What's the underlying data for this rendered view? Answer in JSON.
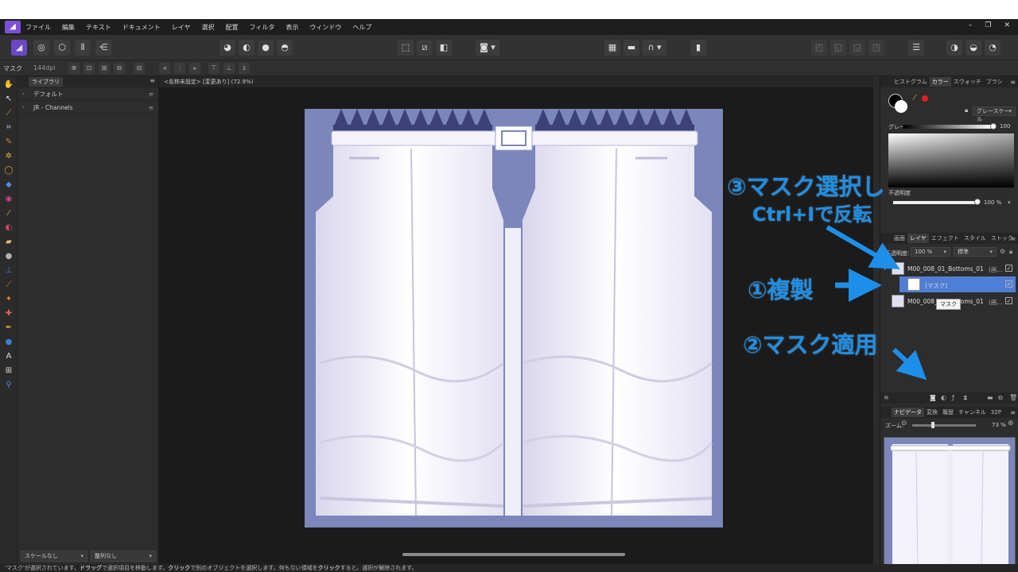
{
  "menu": [
    "ファイル",
    "編集",
    "テキスト",
    "ドキュメント",
    "レイヤ",
    "選択",
    "配置",
    "フィルタ",
    "表示",
    "ウィンドウ",
    "ヘルプ"
  ],
  "context": {
    "mode": "マスク",
    "dpi": "144dpi"
  },
  "library": {
    "tab": "ライブラリ",
    "items": [
      "デフォルト",
      "JR - Channels"
    ],
    "scale_select": "スケールなし",
    "align_select": "整列なし",
    "search_placeholder": "検索"
  },
  "document": {
    "title": "<名称未設定> [変更あり] (72.9%)"
  },
  "color_panel": {
    "tabs": [
      "ヒストグラム",
      "カラー",
      "スウォッチ",
      "ブラシ"
    ],
    "active_tab": "カラー",
    "model": "グレースケール",
    "gray_label": "グレー",
    "gray_value": "100",
    "opacity_label": "不透明度",
    "opacity_value": "100 %"
  },
  "layers_panel": {
    "tabs": [
      "画面",
      "レイヤ",
      "エフェクト",
      "スタイル",
      "ストック"
    ],
    "active_tab": "レイヤ",
    "opacity_label": "不透明度:",
    "opacity_value": "100 %",
    "blend_mode": "標準",
    "layers": [
      {
        "name": "M00_008_01_Bottoms_01",
        "suffix": "(画...",
        "level": 0,
        "selected": false
      },
      {
        "name": "(マスク)",
        "level": 1,
        "selected": true
      },
      {
        "name": "M00_008_01_Bottoms_01",
        "suffix": "(画...",
        "level": 0,
        "selected": false
      }
    ],
    "tooltip": "マスク"
  },
  "navigator_panel": {
    "tabs": [
      "ナビゲータ",
      "変換",
      "履歴",
      "チャンネル",
      "32P"
    ],
    "active_tab": "ナビゲータ",
    "zoom_label": "ズーム:",
    "zoom_value": "73 %"
  },
  "status": {
    "prefix": "'マスク'が選択されています。",
    "drag": "ドラッグ",
    "mid1": "で選択項目を移動します。",
    "click": "クリック",
    "mid2": "で別のオブジェクトを選択します。何もない領域を",
    "click2": "クリック",
    "suffix": "すると、選択が解除されます。"
  },
  "annotations": {
    "step3_line1": "③マスク選択し",
    "step3_line2": "Ctrl+Iで反転",
    "step1": "①複製",
    "step2": "②マスク適用"
  },
  "colors": {
    "annotation": "#1e8fe8",
    "accent": "#4f7ed6",
    "canvas_bg": "#7b86bb"
  }
}
